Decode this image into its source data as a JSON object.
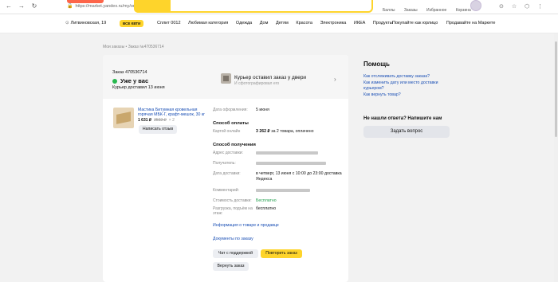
{
  "browser": {
    "url": "https://market.yandex.ru/my/order/470536714"
  },
  "header": {
    "links": [
      "Баллы",
      "Заказы",
      "Избранное",
      "Корзина"
    ]
  },
  "nav": {
    "location": "Литвиновская, 19",
    "all_categories": "ВСЕ КВТИ",
    "categories": [
      "Сплит 0012",
      "Любимая категория",
      "Одежда",
      "Дом",
      "Детям",
      "Красота",
      "Электроника",
      "ИКЕА",
      "Продукты"
    ],
    "business_links": [
      "Покупайте как юрлицо",
      "Продавайте на Маркете"
    ]
  },
  "breadcrumb": "Мои заказы  •  Заказ №470536714",
  "order": {
    "number_label": "Заказ 470536714",
    "status": "Уже у вас",
    "delivered": "Курьер доставил 13 июня",
    "courier_title": "Курьер оставил заказ у двери",
    "courier_sub": "И сфотографировал его"
  },
  "product": {
    "name": "Мастика Битумная кровельная горячая МБК-Г, крафт-мешок, 30 кг",
    "price": "1 631 ₽",
    "old_price": "2502 ₽",
    "qty": "× 2",
    "review_button": "Написать отзыв"
  },
  "details": {
    "date_label": "Дата оформления:",
    "date_value": "5 июня",
    "payment_section": "Способ оплаты",
    "card_label": "Картой онлайн",
    "card_amount": "3 262 ₽",
    "card_value_suffix": "за 2 товара, оплачено",
    "delivery_section": "Способ получения",
    "address_label": "Адрес доставки:",
    "recipient_label": "Получатель:",
    "delivery_date_label": "Дата доставки:",
    "delivery_date_value": "в четверг, 13 июня с 10:00 до 23:00 доставка Яндекса",
    "comment_label": "Комментарий:",
    "cost_label": "Стоимость доставки:",
    "cost_value": "Бесплатно",
    "unload_label": "Разгрузка, подъём на этаж:",
    "unload_value": "бесплатно",
    "info_link": "Информация о товаре и продавце",
    "docs_link": "Документы по заказу"
  },
  "actions": {
    "chat": "Чат с поддержкой",
    "repeat": "Повторить заказ",
    "return": "Вернуть заказ"
  },
  "help": {
    "title": "Помощь",
    "links": [
      "Как отслеживать доставку заказа?",
      "Как изменить дату или место доставки курьером?",
      "Как вернуть товар?"
    ],
    "no_answer": "Не нашли ответа? Напишите нам",
    "ask_button": "Задать вопрос"
  },
  "colors": {
    "accent_yellow": "#fed42b",
    "link_blue": "#1a4fb5",
    "status_green": "#27b84e"
  }
}
